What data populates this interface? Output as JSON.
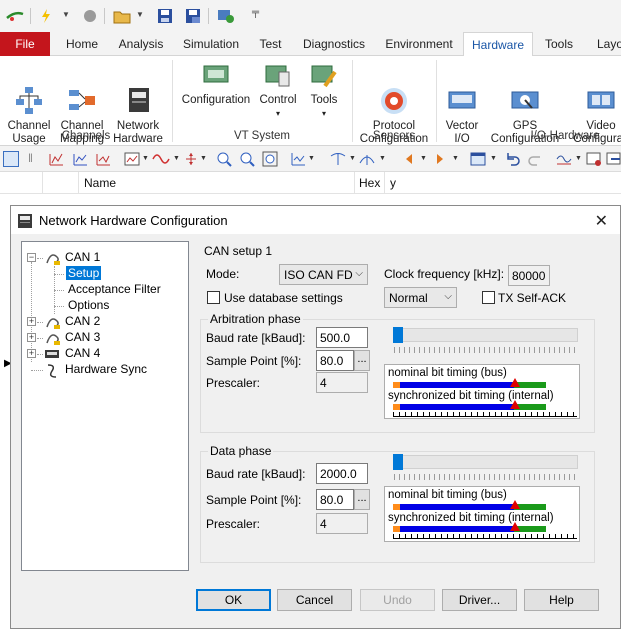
{
  "ribbon_tabs": [
    "File",
    "Home",
    "Analysis",
    "Simulation",
    "Test",
    "Diagnostics",
    "Environment",
    "Hardware",
    "Tools",
    "Layo"
  ],
  "ribbon": {
    "channel_usage": "Channel\nUsage",
    "channel_mapping": "Channel\nMapping",
    "network_hardware": "Network\nHardware",
    "configuration": "Configuration",
    "control": "Control",
    "tools": "Tools",
    "protocol_configuration": "Protocol\nConfiguration",
    "vector_io": "Vector\nI/O",
    "gps_configuration": "GPS\nConfiguration",
    "video_configuration": "Video\nConfigurati",
    "groups": {
      "channels": "Channels",
      "vt_system": "VT System",
      "sensors": "Sensors",
      "io_hardware": "I/O-Hardware"
    }
  },
  "grid_headers": {
    "name": "Name",
    "hex": "Hex",
    "y": "y"
  },
  "dialog": {
    "title": "Network Hardware Configuration",
    "tree": {
      "can1": "CAN 1",
      "setup": "Setup",
      "acceptance_filter": "Acceptance Filter",
      "options": "Options",
      "can2": "CAN 2",
      "can3": "CAN 3",
      "can4": "CAN 4",
      "hardware_sync": "Hardware Sync"
    },
    "setup": {
      "heading": "CAN setup 1",
      "mode_label": "Mode:",
      "mode_value": "ISO CAN FD",
      "clock_label": "Clock frequency [kHz]:",
      "clock_value": "80000",
      "use_db_label": "Use database settings",
      "normal_value": "Normal",
      "tx_self_ack_label": "TX Self-ACK"
    },
    "arbitration": {
      "title": "Arbitration phase",
      "baud_label": "Baud rate [kBaud]:",
      "baud_value": "500.0",
      "sample_label": "Sample Point [%]:",
      "sample_value": "80.0",
      "prescaler_label": "Prescaler:",
      "prescaler_value": "4",
      "nominal_label": "nominal bit timing (bus)",
      "sync_label": "synchronized bit timing (internal)"
    },
    "data": {
      "title": "Data phase",
      "baud_label": "Baud rate [kBaud]:",
      "baud_value": "2000.0",
      "sample_label": "Sample Point [%]:",
      "sample_value": "80.0",
      "prescaler_label": "Prescaler:",
      "prescaler_value": "4",
      "nominal_label": "nominal bit timing (bus)",
      "sync_label": "synchronized bit timing (internal)"
    },
    "ellipsis": "...",
    "buttons": {
      "ok": "OK",
      "cancel": "Cancel",
      "undo": "Undo",
      "driver": "Driver...",
      "help": "Help"
    }
  }
}
